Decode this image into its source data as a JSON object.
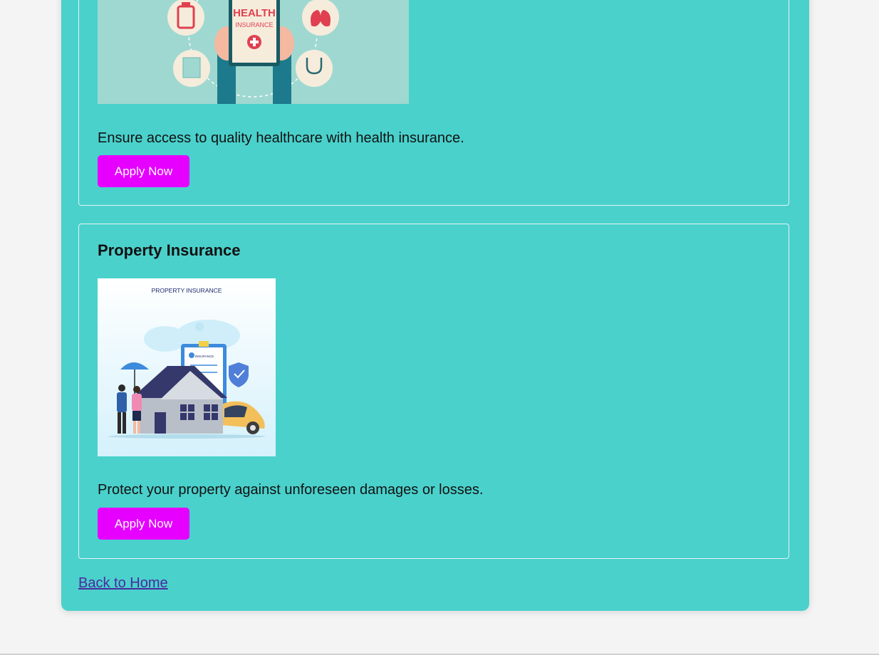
{
  "cards": [
    {
      "title": "",
      "image_label_line1": "HEALTH",
      "image_label_line2": "INSURANCE",
      "description": "Ensure access to quality healthcare with health insurance.",
      "button_label": "Apply Now"
    },
    {
      "title": "Property Insurance",
      "image_label": "PROPERTY INSURANCE",
      "image_clipboard_label": "INSURANCE",
      "description": "Protect your property against unforeseen damages or losses.",
      "button_label": "Apply Now"
    }
  ],
  "footer": {
    "back_link_label": "Back to Home"
  },
  "colors": {
    "background": "#f4f4f4",
    "container": "#4ad1cc",
    "button": "#e600ff",
    "link": "#4b2a9e"
  }
}
